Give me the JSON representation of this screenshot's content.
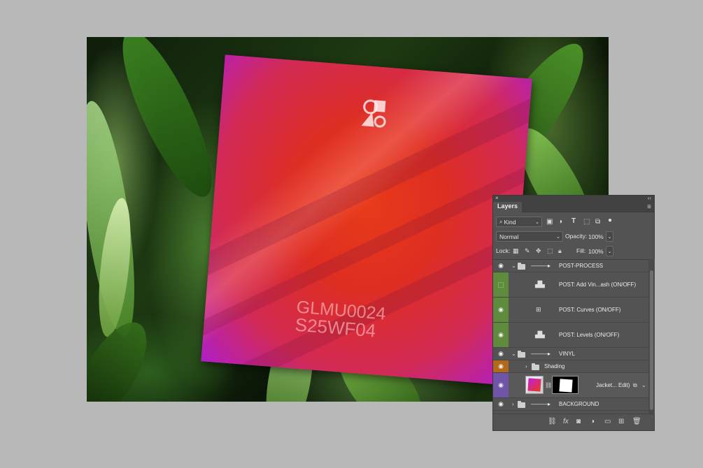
{
  "mockup": {
    "catalog_line1": "GLMU0024",
    "catalog_line2": "S25WF04"
  },
  "panel": {
    "close_glyph": "×",
    "collapse_glyph": "‹‹",
    "tab_label": "Layers",
    "menu_glyph": "≡",
    "filter_kind": "Kind",
    "blend_mode": "Normal",
    "opacity_label": "Opacity:",
    "opacity_value": "100%",
    "lock_label": "Lock:",
    "fill_label": "Fill:",
    "fill_value": "100%"
  },
  "layers": [
    {
      "name": "POST-PROCESS",
      "type": "group",
      "eye": "visible",
      "label_color": "none",
      "expanded": true
    },
    {
      "name": "POST: Add Vin...ash (ON/OFF)",
      "type": "adjustment",
      "eye": "hidden",
      "label_color": "#5e8b3c",
      "icon": "levels-icon"
    },
    {
      "name": "POST: Curves (ON/OFF)",
      "type": "adjustment",
      "eye": "visible",
      "label_color": "#5e8b3c",
      "icon": "curves-icon"
    },
    {
      "name": "POST: Levels (ON/OFF)",
      "type": "adjustment",
      "eye": "visible",
      "label_color": "#5e8b3c",
      "icon": "levels-icon"
    },
    {
      "name": "VINYL",
      "type": "group",
      "eye": "visible",
      "label_color": "none",
      "expanded": true
    },
    {
      "name": "Shading",
      "type": "group",
      "eye": "visible",
      "label_color": "#b26a1a",
      "expanded": false
    },
    {
      "name": "Jacket... Edit)",
      "type": "smart-object",
      "eye": "visible",
      "label_color": "#7054a8"
    },
    {
      "name": "BACKGROUND",
      "type": "group",
      "eye": "visible",
      "label_color": "none",
      "expanded": false
    }
  ],
  "colors": {
    "panel_bg": "#535353",
    "canvas_bg": "#b8b8b8"
  }
}
